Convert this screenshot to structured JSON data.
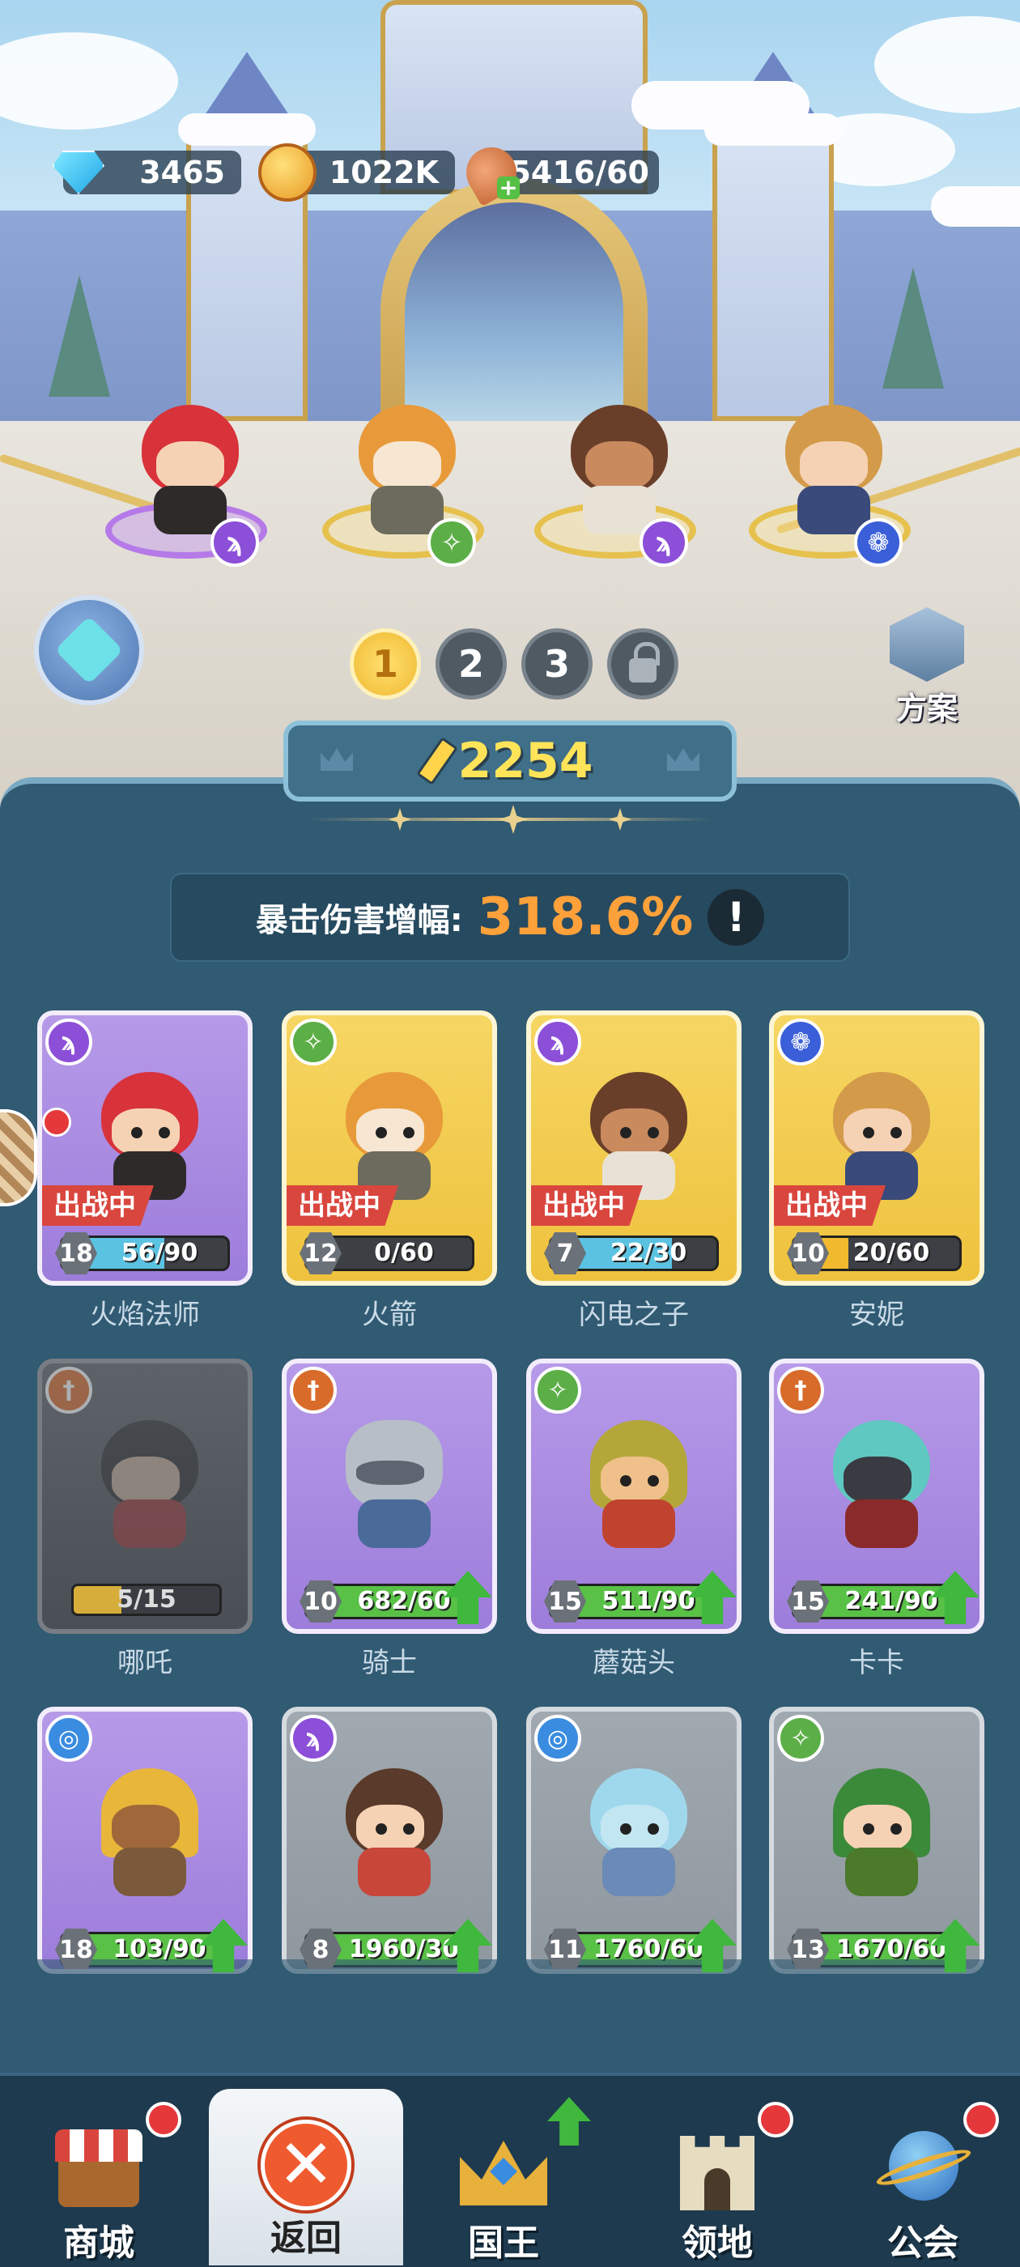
{
  "resources": {
    "gems": "3465",
    "gold": "1022K",
    "stamina": "15416/60"
  },
  "team_tabs": [
    "1",
    "2",
    "3"
  ],
  "plan_label": "方案",
  "power": "2254",
  "crit": {
    "label": "暴击伤害增幅:",
    "value": "318.6%",
    "info": "!"
  },
  "in_battle_label": "出战中",
  "heroes": [
    {
      "name": "火焰法师",
      "level": "18",
      "progress": "56/90",
      "fill": 0.62,
      "class_icon": "mage-staff-icon",
      "state": "in-battle"
    },
    {
      "name": "火箭",
      "level": "12",
      "progress": "0/60",
      "fill": 0.0,
      "class_icon": "ranger-icon",
      "state": "in-battle"
    },
    {
      "name": "闪电之子",
      "level": "7",
      "progress": "22/30",
      "fill": 0.73,
      "class_icon": "mage-staff-icon",
      "state": "in-battle"
    },
    {
      "name": "安妮",
      "level": "10",
      "progress": "20/60",
      "fill": 0.33,
      "class_icon": "beast-paw-icon",
      "state": "in-battle"
    },
    {
      "name": "哪吒",
      "level": "",
      "progress": "5/15",
      "fill": 0.33,
      "class_icon": "warrior-sword-icon",
      "state": "locked"
    },
    {
      "name": "骑士",
      "level": "10",
      "progress": "682/60",
      "fill": 1.0,
      "class_icon": "warrior-sword-icon",
      "state": "upgradable"
    },
    {
      "name": "蘑菇头",
      "level": "15",
      "progress": "511/90",
      "fill": 1.0,
      "class_icon": "ranger-icon",
      "state": "upgradable"
    },
    {
      "name": "卡卡",
      "level": "15",
      "progress": "241/90",
      "fill": 1.0,
      "class_icon": "warrior-sword-icon",
      "state": "upgradable"
    },
    {
      "name": "",
      "level": "18",
      "progress": "103/90",
      "fill": 1.0,
      "class_icon": "frost-swirl-icon",
      "state": "upgradable"
    },
    {
      "name": "",
      "level": "8",
      "progress": "1960/30",
      "fill": 1.0,
      "class_icon": "mage-staff-icon",
      "state": "upgradable"
    },
    {
      "name": "",
      "level": "11",
      "progress": "1760/60",
      "fill": 1.0,
      "class_icon": "frost-swirl-icon",
      "state": "upgradable"
    },
    {
      "name": "",
      "level": "13",
      "progress": "1670/60",
      "fill": 1.0,
      "class_icon": "ranger-icon",
      "state": "upgradable"
    }
  ],
  "nav": [
    {
      "label": "商城",
      "icon": "shop-icon",
      "badge": "red-dot"
    },
    {
      "label": "返回",
      "icon": "close-icon",
      "badge": ""
    },
    {
      "label": "国王",
      "icon": "crown-icon",
      "badge": "upgrade-arrow"
    },
    {
      "label": "领地",
      "icon": "castle-icon",
      "badge": "red-dot"
    },
    {
      "label": "公会",
      "icon": "planet-icon",
      "badge": "red-dot"
    }
  ],
  "colors": {
    "panel": "#315a73",
    "in_battle": "#d9463e",
    "crit_value": "#ffa13a",
    "power_text": "#ffe45a",
    "upgrade_green": "#3fb83d"
  }
}
